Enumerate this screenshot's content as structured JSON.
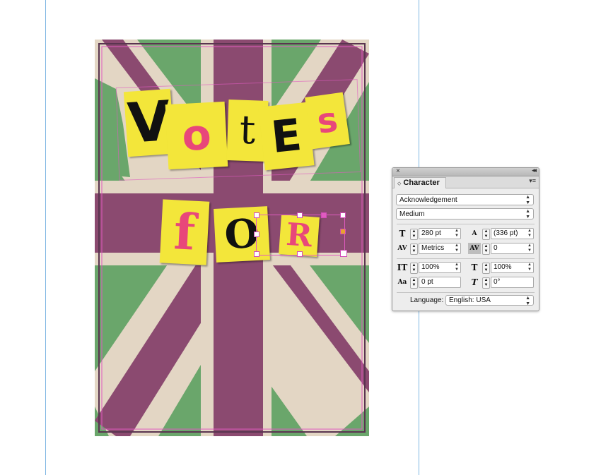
{
  "canvas": {
    "poster_letters": [
      {
        "char": "V",
        "color": "#111111",
        "bg": "#f3e63a"
      },
      {
        "char": "o",
        "color": "#e8477a",
        "bg": "#f3e63a"
      },
      {
        "char": "t",
        "color": "#111111",
        "bg": "#f3e63a"
      },
      {
        "char": "E",
        "color": "#111111",
        "bg": "#f3e63a"
      },
      {
        "char": "s",
        "color": "#e8477a",
        "bg": "#f3e63a"
      },
      {
        "char": "f",
        "color": "#e8477a",
        "bg": "#f3e63a"
      },
      {
        "char": "O",
        "color": "#111111",
        "bg": "#f3e63a"
      },
      {
        "char": "R",
        "color": "#e8477a",
        "bg": "#f3e63a"
      }
    ],
    "colors": {
      "green": "#6aa66b",
      "purple": "#8b4a70",
      "cream": "#e3d6c4",
      "yellow": "#f3e63a",
      "pink": "#e8477a",
      "selection": "#e05bc0",
      "guide": "#7fb6e3"
    }
  },
  "character_panel": {
    "close_icon": "×",
    "collapse_icon": "◂◂",
    "title": "Character",
    "menu_icon": "▾≡",
    "font_family": "Acknowledgement",
    "font_style": "Medium",
    "font_size": "280 pt",
    "leading": "(336 pt)",
    "kerning": "Metrics",
    "tracking": "0",
    "vertical_scale": "100%",
    "horizontal_scale": "100%",
    "baseline_shift": "0 pt",
    "skew": "0°",
    "language_label": "Language:",
    "language_value": "English: USA"
  }
}
